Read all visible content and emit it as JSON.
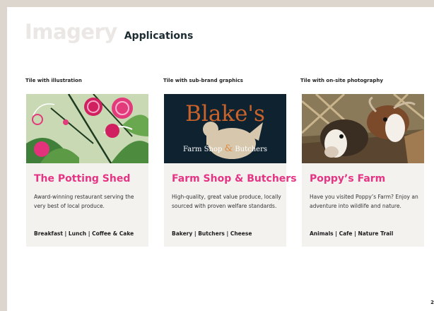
{
  "heading": {
    "section": "Imagery",
    "subsection": "Applications"
  },
  "tiles": [
    {
      "label": "Tile with illustration",
      "title": "The Potting Shed",
      "body": "Award-winning restaurant serving the very best of local produce.",
      "tags": "Breakfast | Lunch | Coffee & Cake",
      "image": "beetroot-illustration"
    },
    {
      "label": "Tile with sub-brand graphics",
      "title": "Farm Shop & Butchers",
      "body": "High-quality, great value produce, locally sourced with proven welfare standards.",
      "tags": "Bakery | Butchers | Cheese",
      "image": "blakes-farm-shop-logo",
      "logo": {
        "name": "Blake's",
        "line1": "Farm Shop",
        "amp": "&",
        "line2": "Butchers"
      }
    },
    {
      "label": "Tile with on-site photography",
      "title": "Poppy’s Farm",
      "body": "Have you visited Poppy’s Farm? Enjoy an adventure into wildlife and nature.",
      "tags": "Animals | Cafe | Nature Trail",
      "image": "goats-photo"
    }
  ],
  "page_number": "2",
  "colors": {
    "accent_pink": "#e63484",
    "navy": "#0f2230",
    "logo_orange": "#c9632b",
    "tile_bg": "#f3f2ef"
  }
}
